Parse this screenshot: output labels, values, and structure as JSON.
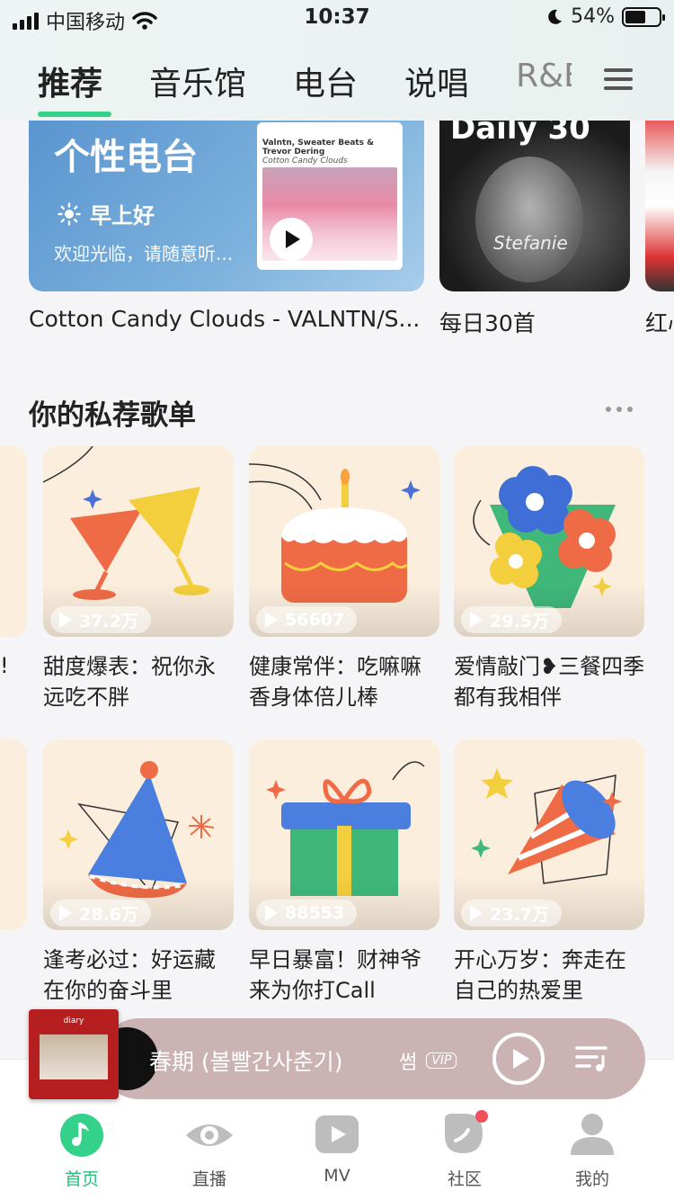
{
  "status": {
    "carrier": "中国移动",
    "time": "10:37",
    "battery": "54%"
  },
  "tabs": [
    "推荐",
    "音乐馆",
    "电台",
    "说唱",
    "R&B"
  ],
  "banner": {
    "radio_title": "个性电台",
    "greeting": "早上好",
    "welcome": "欢迎光临，请随意听...",
    "album_artist": "Valntn, Sweater Beats & Trevor Dering",
    "album_name": "Cotton Candy Clouds",
    "daily_logo": "Daily 30",
    "labels": [
      "Cotton Candy Clouds - VALNTN/S...",
      "每日30首",
      "红心"
    ]
  },
  "section": {
    "title": "你的私荐歌单"
  },
  "playlists": [
    {
      "count": "37.2万",
      "title": "甜度爆表：祝你永远吃不胖"
    },
    {
      "count": "56607",
      "title": "健康常伴：吃嘛嘛香身体倍儿棒"
    },
    {
      "count": "29.5万",
      "title": "爱情敲门❥三餐四季都有我相伴"
    },
    {
      "count": "28.6万",
      "title": "逢考必过：好运藏在你的奋斗里"
    },
    {
      "count": "88553",
      "title": "早日暴富！财神爷来为你打Call"
    },
    {
      "count": "23.7万",
      "title": "开心万岁：奔走在自己的热爱里"
    }
  ],
  "edge_marks": [
    "!"
  ],
  "player": {
    "song": "春期 (볼빨간사춘기)",
    "artist": "썸",
    "vip": "VIP"
  },
  "bottom_nav": [
    "首页",
    "直播",
    "MV",
    "社区",
    "我的"
  ],
  "colors": {
    "accent": "#33d18a",
    "player_bg": "#cbb3b3",
    "badge": "#f0505a"
  }
}
